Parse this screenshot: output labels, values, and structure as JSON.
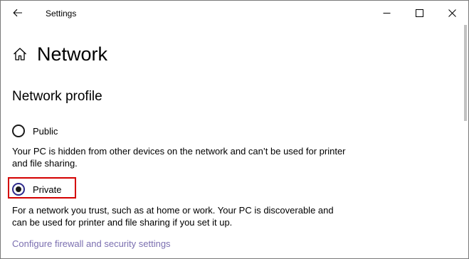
{
  "window": {
    "title": "Settings"
  },
  "page": {
    "title": "Network"
  },
  "section": {
    "title": "Network profile"
  },
  "options": [
    {
      "label": "Public",
      "selected": false,
      "description": "Your PC is hidden from other devices on the network and can’t be used for printer and file sharing."
    },
    {
      "label": "Private",
      "selected": true,
      "description": "For a network you trust, such as at home or work. Your PC is discoverable and can be used for printer and file sharing if you set it up."
    }
  ],
  "link": {
    "label": "Configure firewall and security settings"
  },
  "icons": {
    "back": "back-arrow-icon",
    "home": "home-icon",
    "minimize": "minimize-icon",
    "maximize": "maximize-icon",
    "close": "close-icon"
  },
  "colors": {
    "link": "#7b6fb0",
    "highlight": "#d40000",
    "radio_selected_ring": "#2f2b8c"
  }
}
